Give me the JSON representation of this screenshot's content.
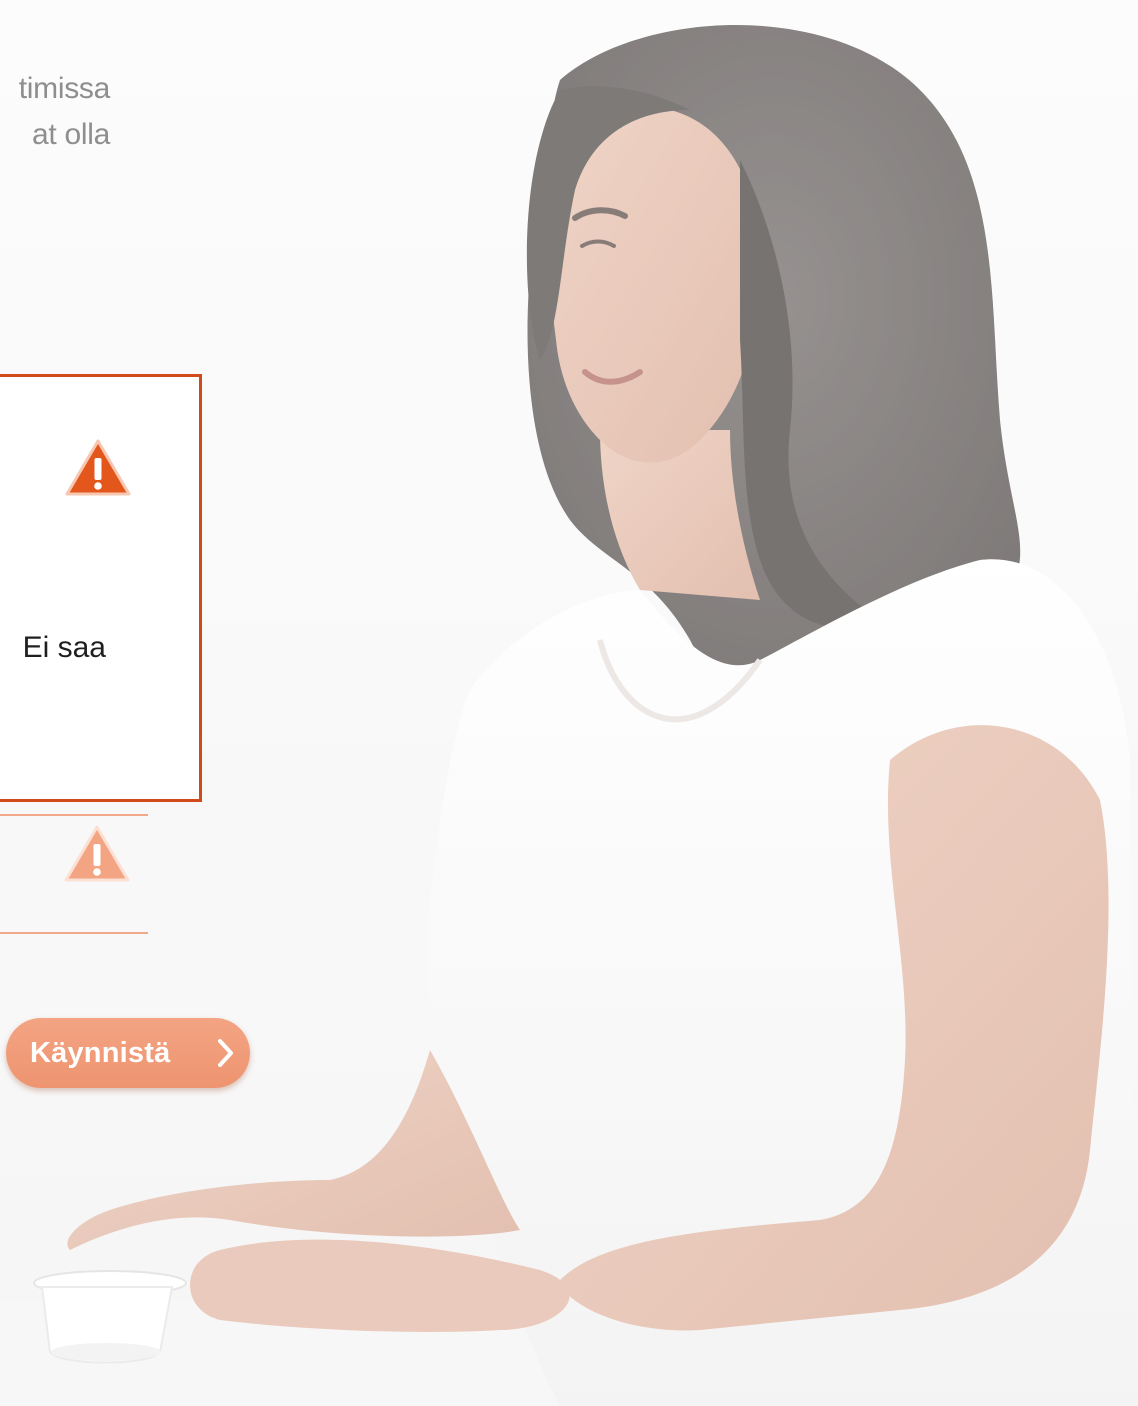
{
  "intro": {
    "lines": [
      "timissa",
      "at olla"
    ]
  },
  "warning_box": {
    "text": "Ei saa",
    "icon": "warning-icon"
  },
  "secondary_warning": {
    "icon": "warning-icon"
  },
  "start_button": {
    "label": "Käynnistä",
    "icon": "chevron-right-icon"
  },
  "colors": {
    "accent": "#d24a1a",
    "button": "#ef9a76",
    "warning_icon": "#e4571c",
    "warning_icon_light": "#f3a482",
    "divider": "#f1a98a",
    "muted_text": "#8e8e8e"
  }
}
